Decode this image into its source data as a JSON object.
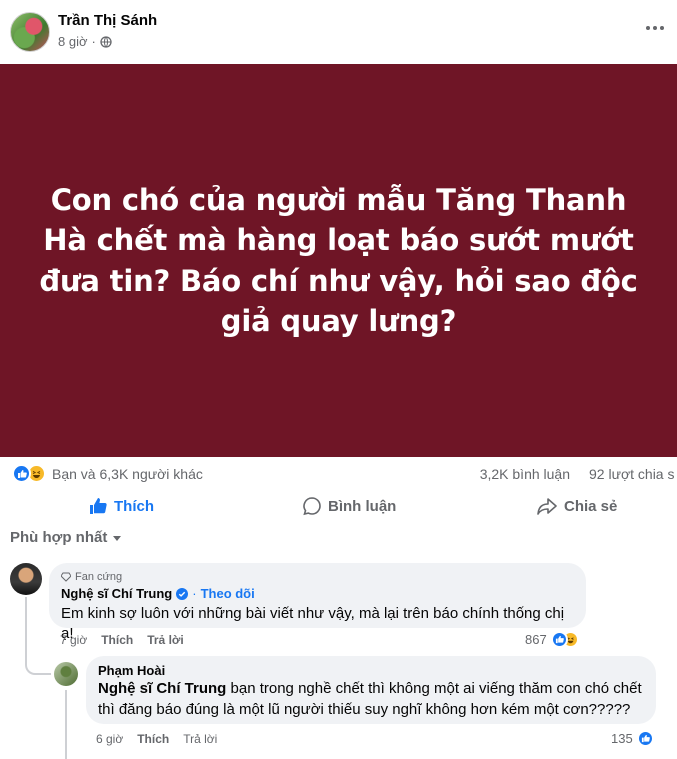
{
  "post": {
    "author": "Trần Thị Sánh",
    "time": "8 giờ",
    "image_text": "Con chó của người mẫu Tăng Thanh Hà chết mà hàng loạt báo sướt mướt đưa tin? Báo chí như vậy, hỏi sao độc giả quay lưng?",
    "image_bg": "#6f1526"
  },
  "stats": {
    "reactors": "Bạn và 6,3K người khác",
    "comments": "3,2K bình luận",
    "shares": "92 lượt chia s"
  },
  "actions": {
    "like": "Thích",
    "comment": "Bình luận",
    "share": "Chia sẻ"
  },
  "filter": {
    "label": "Phù hợp nhất"
  },
  "comments": [
    {
      "badge": "Fan cứng",
      "name": "Nghệ sĩ Chí Trung",
      "follow": "Theo dõi",
      "text": "Em kinh sợ luôn với những bài viết như vậy, mà lại trên báo chính thống chị ạ!",
      "time": "7 giờ",
      "like": "Thích",
      "reply": "Trả lời",
      "reactions": "867"
    },
    {
      "name": "Phạm Hoài",
      "tag": "Nghệ sĩ Chí Trung",
      "text": " bạn trong nghề chết thì không một ai viếng thăm con chó chết thì đăng báo đúng là một lũ người thiếu suy nghĩ không hơn kém một cơn?????",
      "time": "6 giờ",
      "like": "Thích",
      "reply": "Trả lời",
      "reactions": "135"
    }
  ],
  "colors": {
    "accent": "#1877f2",
    "muted": "#65676b",
    "bubble": "#f0f2f5"
  }
}
